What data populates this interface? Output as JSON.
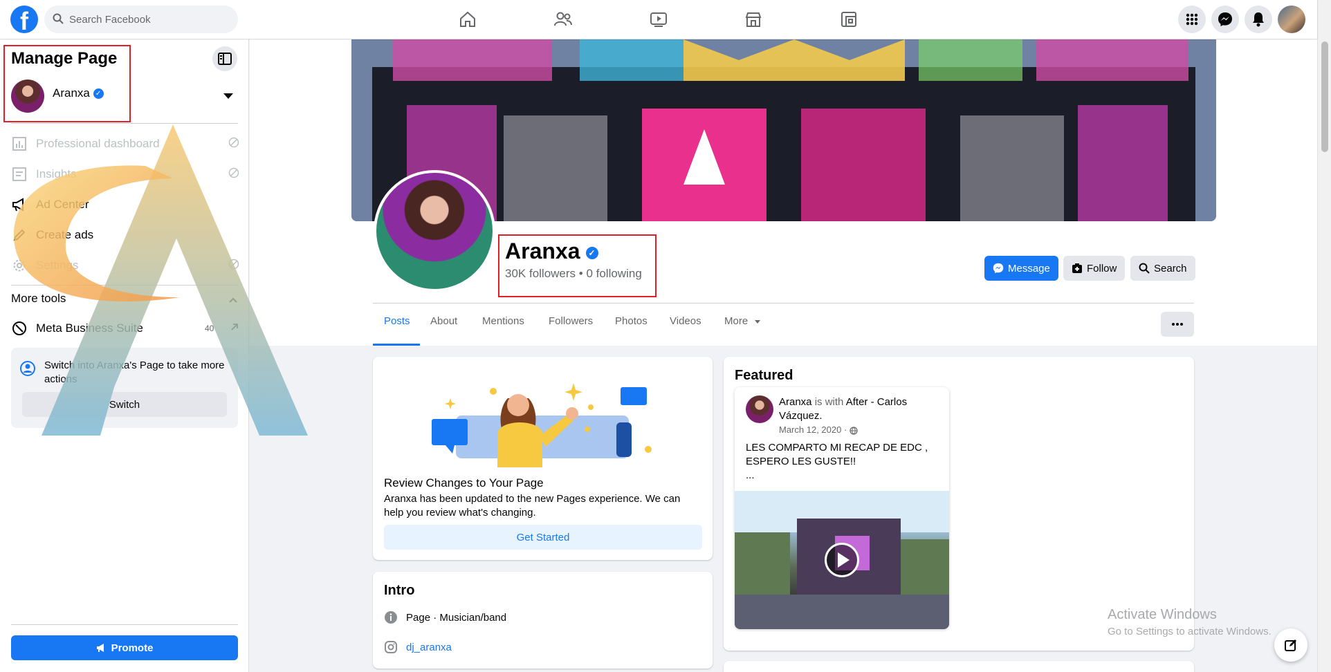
{
  "topbar": {
    "search_placeholder": "Search Facebook",
    "logo": "f",
    "nav_icons": [
      "home-icon",
      "friends-icon",
      "watch-icon",
      "marketplace-icon",
      "gaming-icon"
    ],
    "right_icons": [
      "menu-grid-icon",
      "messenger-icon",
      "notifications-icon",
      "account-avatar"
    ]
  },
  "sidebar": {
    "title": "Manage Page",
    "page_name": "Aranxa",
    "items": [
      {
        "label": "Professional dashboard",
        "icon": "dashboard-icon",
        "disabled": true
      },
      {
        "label": "Insights",
        "icon": "insights-icon",
        "disabled": true
      },
      {
        "label": "Ad Center",
        "icon": "megaphone-icon",
        "disabled": false
      },
      {
        "label": "Create ads",
        "icon": "pencil-icon",
        "disabled": false
      },
      {
        "label": "Settings",
        "icon": "gear-icon",
        "disabled": true
      }
    ],
    "more_tools_label": "More tools",
    "meta_suite": {
      "label": "Meta Business Suite",
      "badge": "40"
    },
    "switch_card": {
      "text": "Switch into Aranxa's Page to take more actions",
      "button": "Switch"
    },
    "promote_label": "Promote"
  },
  "profile": {
    "name": "Aranxa",
    "stats": "30K followers • 0 following",
    "buttons": {
      "message": "Message",
      "follow": "Follow",
      "search": "Search"
    }
  },
  "tabs": [
    {
      "label": "Posts",
      "active": true
    },
    {
      "label": "About",
      "active": false
    },
    {
      "label": "Mentions",
      "active": false
    },
    {
      "label": "Followers",
      "active": false
    },
    {
      "label": "Photos",
      "active": false
    },
    {
      "label": "Videos",
      "active": false
    },
    {
      "label": "More",
      "active": false
    }
  ],
  "review_card": {
    "title": "Review Changes to Your Page",
    "desc": "Aranxa has been updated to the new Pages experience. We can help you review what's changing.",
    "button": "Get Started"
  },
  "intro": {
    "title": "Intro",
    "category_label": "Page",
    "category": "Musician/band",
    "instagram": "dj_aranxa"
  },
  "featured": {
    "title": "Featured",
    "post": {
      "author": "Aranxa",
      "with_text": "is with",
      "tagged": "After - Carlos Vázquez",
      "date": "March 12, 2020 · ",
      "text": "LES COMPARTO MI RECAP DE EDC , ESPERO LES GUSTE!!",
      "ellipsis": "..."
    }
  },
  "watermark": {
    "title": "Activate Windows",
    "sub": "Go to Settings to activate Windows."
  },
  "colors": {
    "brand": "#1877f2",
    "annotation": "#e41e26"
  }
}
